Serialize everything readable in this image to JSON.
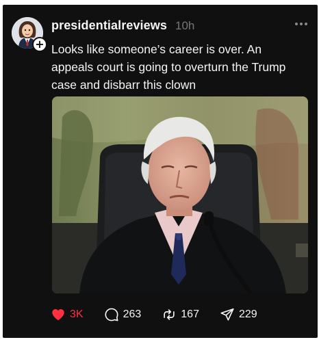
{
  "post": {
    "username": "presidentialreviews",
    "timestamp": "10h",
    "text": "Looks like someone’s career is over. An appeals court is going to overturn the Trump case and disbarr this clown",
    "follow_symbol": "+"
  },
  "actions": {
    "like": {
      "icon": "heart-icon",
      "count": "3K",
      "liked": true
    },
    "reply": {
      "icon": "comment-bubble-icon",
      "count": "263"
    },
    "repost": {
      "icon": "repost-icon",
      "count": "167"
    },
    "share": {
      "icon": "send-icon",
      "count": "229"
    }
  },
  "colors": {
    "background": "#101010",
    "text": "#f3f5f7",
    "muted": "#777777",
    "like": "#ff3040"
  }
}
